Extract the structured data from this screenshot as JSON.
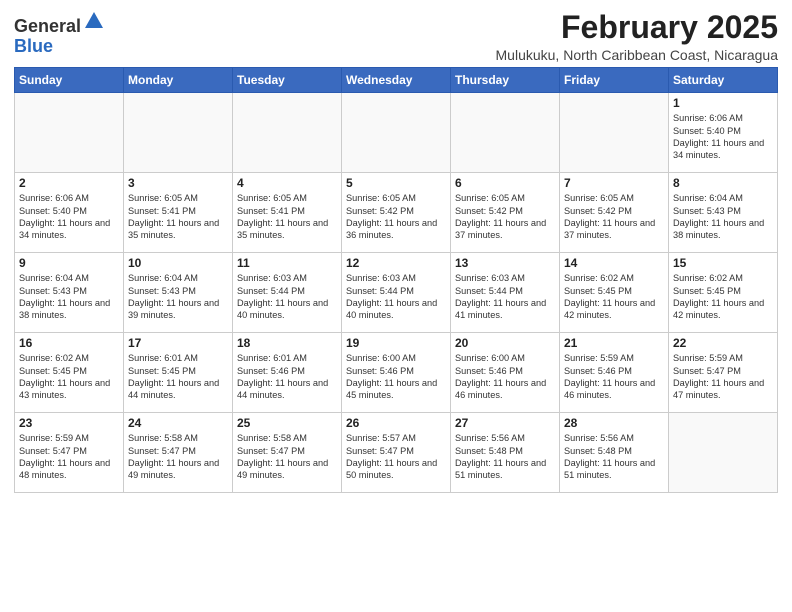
{
  "header": {
    "logo_general": "General",
    "logo_blue": "Blue",
    "title": "February 2025",
    "subtitle": "Mulukuku, North Caribbean Coast, Nicaragua"
  },
  "days_of_week": [
    "Sunday",
    "Monday",
    "Tuesday",
    "Wednesday",
    "Thursday",
    "Friday",
    "Saturday"
  ],
  "weeks": [
    [
      {
        "day": "",
        "info": ""
      },
      {
        "day": "",
        "info": ""
      },
      {
        "day": "",
        "info": ""
      },
      {
        "day": "",
        "info": ""
      },
      {
        "day": "",
        "info": ""
      },
      {
        "day": "",
        "info": ""
      },
      {
        "day": "1",
        "info": "Sunrise: 6:06 AM\nSunset: 5:40 PM\nDaylight: 11 hours\nand 34 minutes."
      }
    ],
    [
      {
        "day": "2",
        "info": "Sunrise: 6:06 AM\nSunset: 5:40 PM\nDaylight: 11 hours\nand 34 minutes."
      },
      {
        "day": "3",
        "info": "Sunrise: 6:05 AM\nSunset: 5:41 PM\nDaylight: 11 hours\nand 35 minutes."
      },
      {
        "day": "4",
        "info": "Sunrise: 6:05 AM\nSunset: 5:41 PM\nDaylight: 11 hours\nand 35 minutes."
      },
      {
        "day": "5",
        "info": "Sunrise: 6:05 AM\nSunset: 5:42 PM\nDaylight: 11 hours\nand 36 minutes."
      },
      {
        "day": "6",
        "info": "Sunrise: 6:05 AM\nSunset: 5:42 PM\nDaylight: 11 hours\nand 37 minutes."
      },
      {
        "day": "7",
        "info": "Sunrise: 6:05 AM\nSunset: 5:42 PM\nDaylight: 11 hours\nand 37 minutes."
      },
      {
        "day": "8",
        "info": "Sunrise: 6:04 AM\nSunset: 5:43 PM\nDaylight: 11 hours\nand 38 minutes."
      }
    ],
    [
      {
        "day": "9",
        "info": "Sunrise: 6:04 AM\nSunset: 5:43 PM\nDaylight: 11 hours\nand 38 minutes."
      },
      {
        "day": "10",
        "info": "Sunrise: 6:04 AM\nSunset: 5:43 PM\nDaylight: 11 hours\nand 39 minutes."
      },
      {
        "day": "11",
        "info": "Sunrise: 6:03 AM\nSunset: 5:44 PM\nDaylight: 11 hours\nand 40 minutes."
      },
      {
        "day": "12",
        "info": "Sunrise: 6:03 AM\nSunset: 5:44 PM\nDaylight: 11 hours\nand 40 minutes."
      },
      {
        "day": "13",
        "info": "Sunrise: 6:03 AM\nSunset: 5:44 PM\nDaylight: 11 hours\nand 41 minutes."
      },
      {
        "day": "14",
        "info": "Sunrise: 6:02 AM\nSunset: 5:45 PM\nDaylight: 11 hours\nand 42 minutes."
      },
      {
        "day": "15",
        "info": "Sunrise: 6:02 AM\nSunset: 5:45 PM\nDaylight: 11 hours\nand 42 minutes."
      }
    ],
    [
      {
        "day": "16",
        "info": "Sunrise: 6:02 AM\nSunset: 5:45 PM\nDaylight: 11 hours\nand 43 minutes."
      },
      {
        "day": "17",
        "info": "Sunrise: 6:01 AM\nSunset: 5:45 PM\nDaylight: 11 hours\nand 44 minutes."
      },
      {
        "day": "18",
        "info": "Sunrise: 6:01 AM\nSunset: 5:46 PM\nDaylight: 11 hours\nand 44 minutes."
      },
      {
        "day": "19",
        "info": "Sunrise: 6:00 AM\nSunset: 5:46 PM\nDaylight: 11 hours\nand 45 minutes."
      },
      {
        "day": "20",
        "info": "Sunrise: 6:00 AM\nSunset: 5:46 PM\nDaylight: 11 hours\nand 46 minutes."
      },
      {
        "day": "21",
        "info": "Sunrise: 5:59 AM\nSunset: 5:46 PM\nDaylight: 11 hours\nand 46 minutes."
      },
      {
        "day": "22",
        "info": "Sunrise: 5:59 AM\nSunset: 5:47 PM\nDaylight: 11 hours\nand 47 minutes."
      }
    ],
    [
      {
        "day": "23",
        "info": "Sunrise: 5:59 AM\nSunset: 5:47 PM\nDaylight: 11 hours\nand 48 minutes."
      },
      {
        "day": "24",
        "info": "Sunrise: 5:58 AM\nSunset: 5:47 PM\nDaylight: 11 hours\nand 49 minutes."
      },
      {
        "day": "25",
        "info": "Sunrise: 5:58 AM\nSunset: 5:47 PM\nDaylight: 11 hours\nand 49 minutes."
      },
      {
        "day": "26",
        "info": "Sunrise: 5:57 AM\nSunset: 5:47 PM\nDaylight: 11 hours\nand 50 minutes."
      },
      {
        "day": "27",
        "info": "Sunrise: 5:56 AM\nSunset: 5:48 PM\nDaylight: 11 hours\nand 51 minutes."
      },
      {
        "day": "28",
        "info": "Sunrise: 5:56 AM\nSunset: 5:48 PM\nDaylight: 11 hours\nand 51 minutes."
      },
      {
        "day": "",
        "info": ""
      }
    ]
  ]
}
